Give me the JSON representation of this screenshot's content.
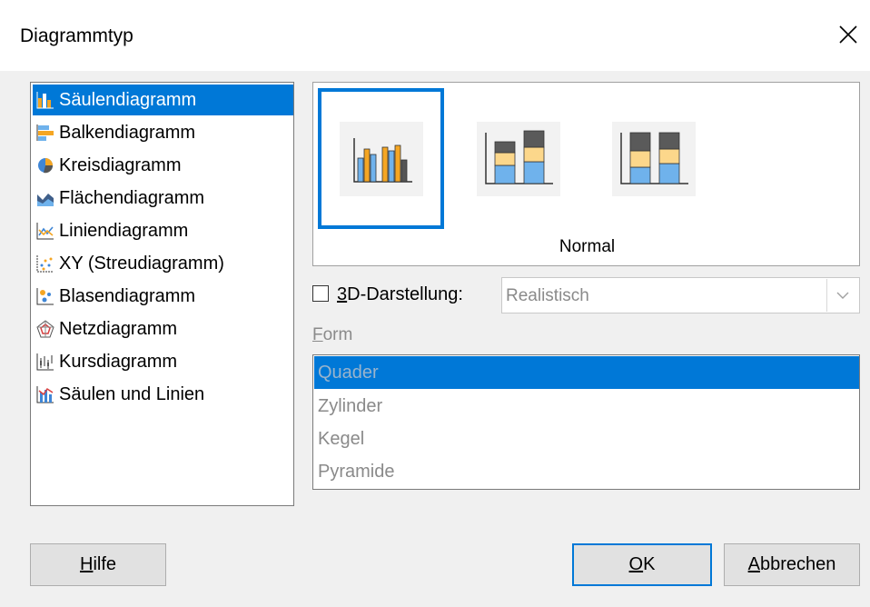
{
  "dialog": {
    "title": "Diagrammtyp"
  },
  "types": [
    {
      "label": "Säulendiagramm",
      "icon": "column-chart-icon",
      "selected": true
    },
    {
      "label": "Balkendiagramm",
      "icon": "bar-chart-icon"
    },
    {
      "label": "Kreisdiagramm",
      "icon": "pie-chart-icon"
    },
    {
      "label": "Flächendiagramm",
      "icon": "area-chart-icon"
    },
    {
      "label": "Liniendiagramm",
      "icon": "line-chart-icon"
    },
    {
      "label": "XY (Streudiagramm)",
      "icon": "scatter-chart-icon"
    },
    {
      "label": "Blasendiagramm",
      "icon": "bubble-chart-icon"
    },
    {
      "label": "Netzdiagramm",
      "icon": "net-chart-icon"
    },
    {
      "label": "Kursdiagramm",
      "icon": "stock-chart-icon"
    },
    {
      "label": "Säulen und Linien",
      "icon": "column-line-chart-icon"
    }
  ],
  "variants": {
    "selected_label": "Normal"
  },
  "three_d": {
    "checkbox_label_rest": "D-Darstellung:",
    "checkbox_label_key": "3",
    "checked": false,
    "style_value": "Realistisch"
  },
  "form": {
    "label_key": "F",
    "label_rest": "orm",
    "items": [
      "Quader",
      "Zylinder",
      "Kegel",
      "Pyramide"
    ],
    "selected": "Quader"
  },
  "buttons": {
    "help_key": "H",
    "help_rest": "ilfe",
    "ok_key": "O",
    "ok_rest": "K",
    "cancel_key": "A",
    "cancel_rest": "bbrechen"
  },
  "colors": {
    "accent": "#0078d7",
    "orange": "#f5a623",
    "blue": "#6fb2ec",
    "dark": "#5a5a5a",
    "light_orange": "#fcd78b"
  }
}
